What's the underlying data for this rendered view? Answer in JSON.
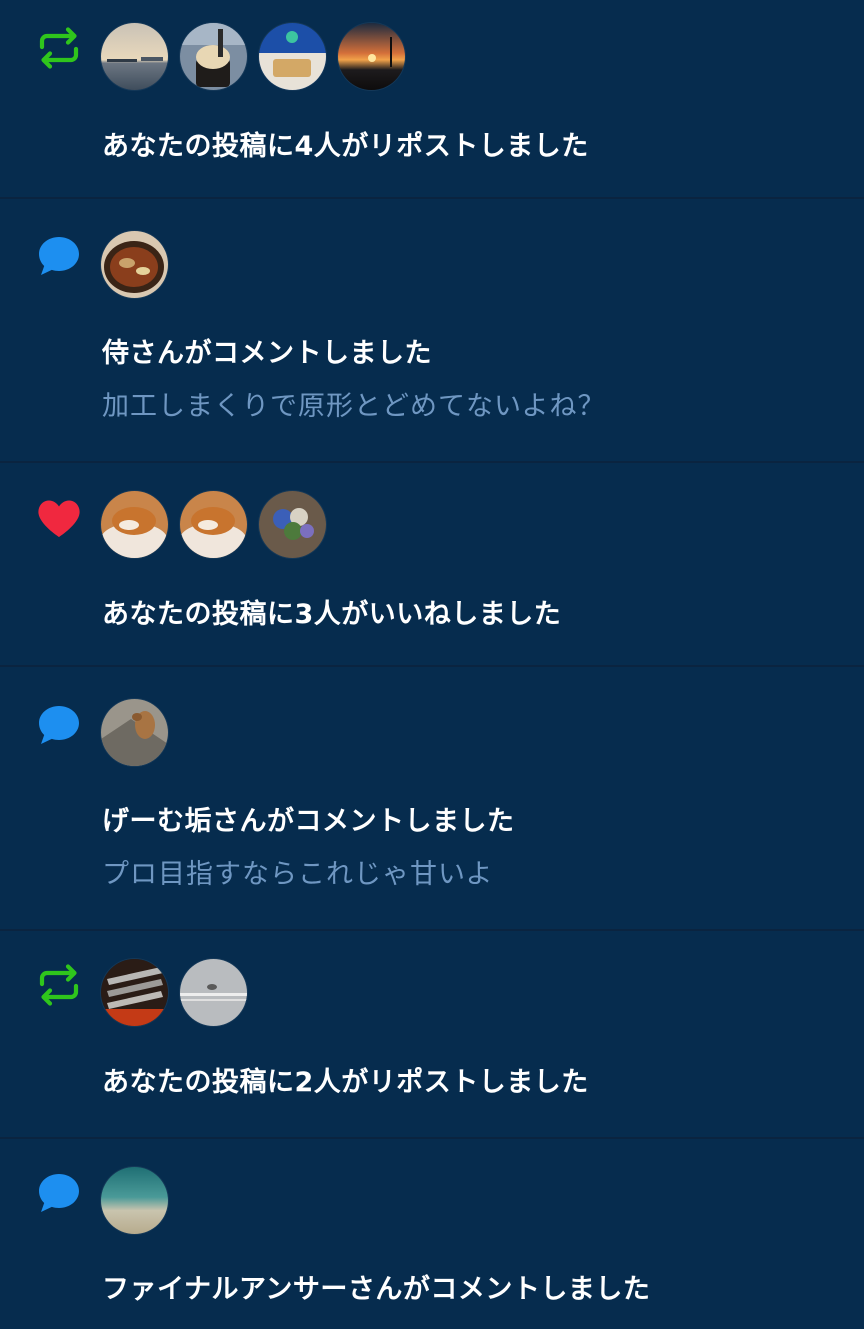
{
  "colors": {
    "background": "#062c4e",
    "divider": "#0a2440",
    "repost_green": "#2fc51c",
    "comment_blue": "#1d8ff0",
    "like_red": "#f0283f",
    "comment_text": "#6f97c2",
    "title_text": "#ffffff"
  },
  "notifications": [
    {
      "type": "repost",
      "icon": "repost-icon",
      "avatars": [
        "avatar-harbor",
        "avatar-ice-cream",
        "avatar-waffle",
        "avatar-sunset"
      ],
      "title": "あなたの投稿に4人がリポストしました",
      "comment": ""
    },
    {
      "type": "comment",
      "icon": "comment-bubble-icon",
      "avatars": [
        "avatar-ramen"
      ],
      "title": "侍さんがコメントしました",
      "comment": "加工しまくりで原形とどめてないよね？"
    },
    {
      "type": "like",
      "icon": "heart-icon",
      "avatars": [
        "avatar-shiba",
        "avatar-shiba",
        "avatar-flowers"
      ],
      "title": "あなたの投稿に3人がいいねしました",
      "comment": ""
    },
    {
      "type": "comment",
      "icon": "comment-bubble-icon",
      "avatars": [
        "avatar-deer"
      ],
      "title": "げーむ垢さんがコメントしました",
      "comment": "プロ目指すならこれじゃ甘いよ"
    },
    {
      "type": "repost",
      "icon": "repost-icon",
      "avatars": [
        "avatar-grilled-fish",
        "avatar-bird"
      ],
      "title": "あなたの投稿に2人がリポストしました",
      "comment": ""
    },
    {
      "type": "comment",
      "icon": "comment-bubble-icon",
      "avatars": [
        "avatar-sea"
      ],
      "title": "ファイナルアンサーさんがコメントしました",
      "comment": ""
    }
  ]
}
